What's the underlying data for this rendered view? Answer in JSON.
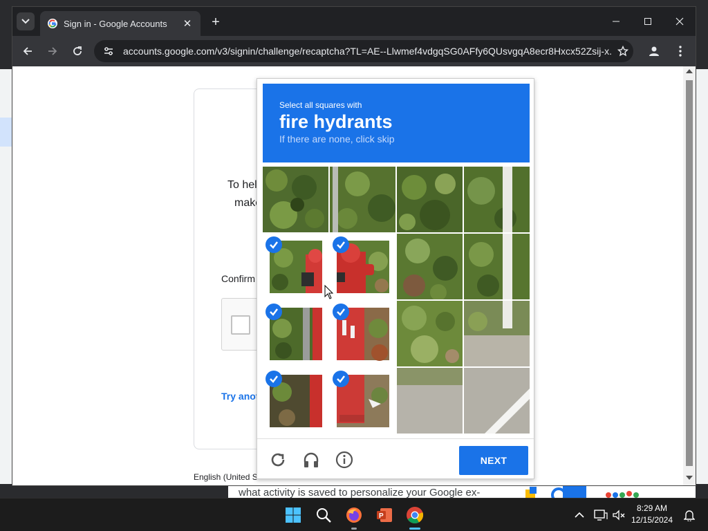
{
  "browser": {
    "tab_title": "Sign in - Google Accounts",
    "url": "accounts.google.com/v3/signin/challenge/recaptcha?TL=AE--Llwmef4vdgqSG0AFfy6QUsvgqA8ecr8Hxcx52Zsij-x..."
  },
  "page": {
    "text_line1": "To hel",
    "text_line2": "make",
    "confirm_label": "Confirm",
    "try_another": "Try anot",
    "language": "English (United S"
  },
  "captcha": {
    "instruction_top": "Select all squares with",
    "target": "fire hydrants",
    "instruction_bottom": "If there are none, click skip",
    "next_label": "NEXT",
    "selected_tiles": 6,
    "grid_size": 4
  },
  "background": {
    "behind_text": "what activity is saved to personalize your Google ex-"
  },
  "taskbar": {
    "time": "8:29 AM",
    "date": "12/15/2024"
  },
  "colors": {
    "accent": "#1a73e8",
    "browser_dark": "#202124",
    "taskbar": "#1c1c1c"
  }
}
